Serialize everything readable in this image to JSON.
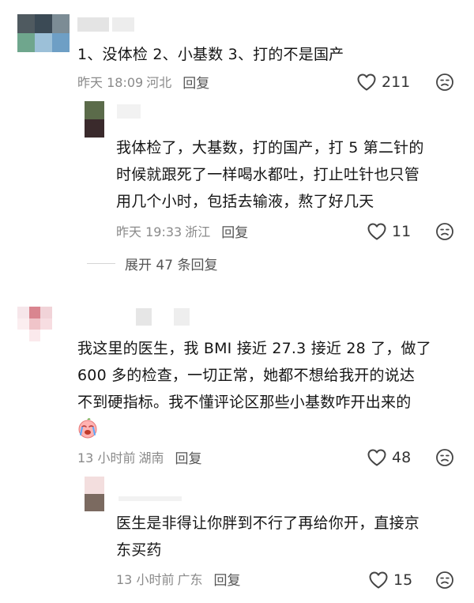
{
  "comments": [
    {
      "text_lines": [
        "1、没体检 2、小基数 3、打的不是国产"
      ],
      "time": "昨天 18:09",
      "location": "河北",
      "reply_label": "回复",
      "likes": "211",
      "replies": [
        {
          "text_lines": [
            "我体检了，大基数，打的国产，打 5 第二针的",
            "时候就跟死了一样喝水都吐，打止吐针也只管",
            "用几个小时，包括去输液，熬了好几天"
          ],
          "time": "昨天 19:33",
          "location": "浙江",
          "reply_label": "回复",
          "likes": "11"
        }
      ],
      "expand_label": "展开 47 条回复"
    },
    {
      "text_lines": [
        "我这里的医生，我 BMI 接近 27.3 接近 28 了，做了",
        "600 多的检查，一切正常，她都不想给我开的说达",
        "不到硬指标。我不懂评论区那些小基数咋开出来的"
      ],
      "emoji": "crying-face-emoji",
      "time": "13 小时前",
      "location": "湖南",
      "reply_label": "回复",
      "likes": "48",
      "replies": [
        {
          "text_lines": [
            "医生是非得让你胖到不行了再给你开，直接京",
            "东买药"
          ],
          "time": "13 小时前",
          "location": "广东",
          "reply_label": "回复",
          "likes": "15"
        }
      ]
    }
  ],
  "icons": {
    "like": "heart-outline-icon",
    "dislike": "frown-face-icon"
  },
  "colors": {
    "text": "#161616",
    "meta": "#8a8a8a",
    "icon": "#444444"
  }
}
